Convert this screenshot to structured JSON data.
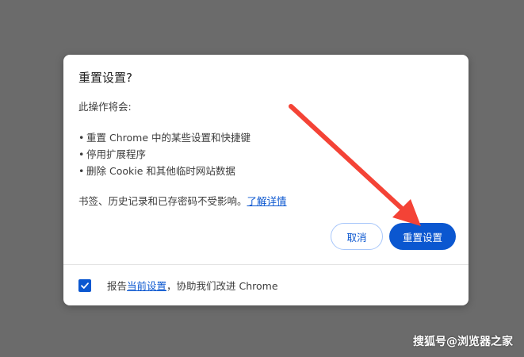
{
  "dialog": {
    "title": "重置设置?",
    "intro": "此操作将会:",
    "bullets": [
      "重置 Chrome 中的某些设置和快捷键",
      "停用扩展程序",
      "删除 Cookie 和其他临时网站数据"
    ],
    "bullet_symbol": "•",
    "note_text": "书签、历史记录和已存密码不受影响。",
    "learn_more_link": "了解详情",
    "cancel_label": "取消",
    "reset_label": "重置设置",
    "footer": {
      "prefix": "报告",
      "link": "当前设置",
      "suffix": "，协助我们改进 Chrome",
      "checked": true
    }
  },
  "watermark": "搜狐号@浏览器之家",
  "colors": {
    "accent": "#0b57d0",
    "arrow": "#f44336",
    "backdrop": "#6b6b6b"
  },
  "icons": {
    "checkmark": "check-icon",
    "annotation_arrow": "arrow-annotation"
  }
}
